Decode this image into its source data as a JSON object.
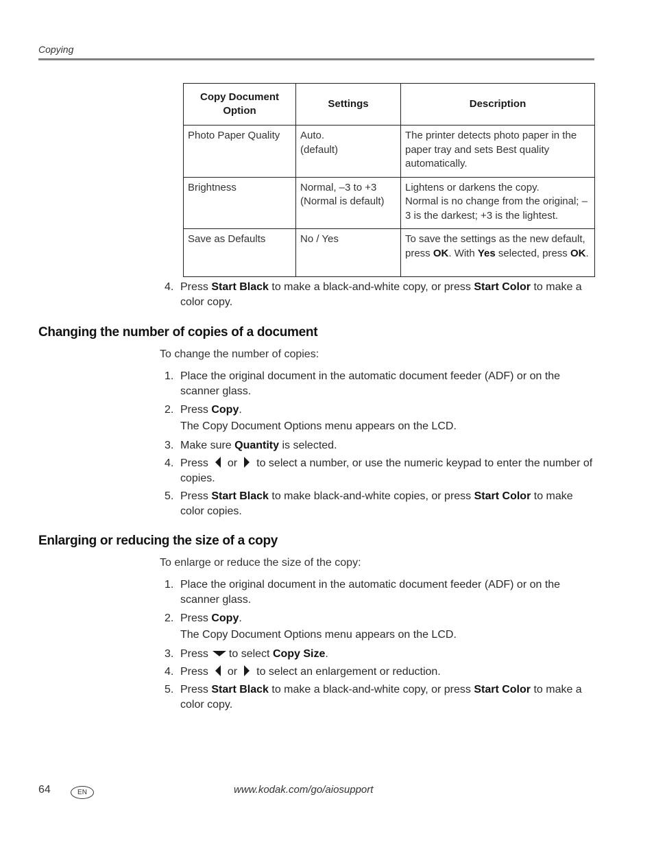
{
  "header": {
    "running_head": "Copying"
  },
  "table": {
    "headers": [
      "Copy Document Option",
      "Settings",
      "Description"
    ],
    "rows": [
      {
        "option": "Photo Paper Quality",
        "settings_line1": "Auto.",
        "settings_line2": "(default)",
        "description": "The printer detects photo paper in the paper tray and sets Best quality automatically."
      },
      {
        "option": "Brightness",
        "settings_line1": "Normal, –3 to +3",
        "settings_line2": "(Normal is default)",
        "description_line1": "Lightens or darkens the copy.",
        "description_line2": "Normal is no change from the original; –3 is the darkest; +3 is the lightest."
      },
      {
        "option": "Save as Defaults",
        "settings_line1": "No / Yes",
        "desc_part1": "To save the settings as the new default, press ",
        "desc_bold1": "OK",
        "desc_part2": ". With ",
        "desc_bold2": "Yes",
        "desc_part3": " selected, press ",
        "desc_bold3": "OK",
        "desc_part4": "."
      }
    ]
  },
  "pre_step": {
    "num": "4.",
    "t1": "Press ",
    "b1": "Start Black",
    "t2": " to make a black-and-white copy, or press ",
    "b2": "Start Color",
    "t3": " to make a color copy."
  },
  "section1": {
    "heading": "Changing the number of copies of a document",
    "intro": "To change the number of copies:",
    "steps": [
      {
        "num": "1.",
        "text": "Place the original document in the automatic document feeder (ADF) or on the scanner glass."
      },
      {
        "num": "2.",
        "t1": "Press ",
        "b1": "Copy",
        "t2": "."
      },
      {
        "num": "3.",
        "t1": "Make sure ",
        "b1": "Quantity",
        "t2": " is selected."
      },
      {
        "num": "4.",
        "t1": "Press",
        "or": "or",
        "t2": "to select a number, or use the numeric keypad to enter the number of copies.",
        "icons": [
          "left-arrow-icon",
          "right-arrow-icon"
        ]
      },
      {
        "num": "5.",
        "t1": "Press ",
        "b1": "Start Black",
        "t2": " to make black-and-white copies, or press ",
        "b2": "Start Color",
        "t3": " to make color copies."
      }
    ],
    "note": "The Copy Document Options menu appears on the LCD."
  },
  "section2": {
    "heading": "Enlarging or reducing the size of a copy",
    "intro": "To enlarge or reduce the size of the copy:",
    "steps": [
      {
        "num": "1.",
        "text": "Place the original document in the automatic document feeder (ADF) or on the scanner glass."
      },
      {
        "num": "2.",
        "t1": "Press ",
        "b1": "Copy",
        "t2": "."
      },
      {
        "num": "3.",
        "t1": "Press",
        "t2": "to select ",
        "b1": "Copy Size",
        "t3": ".",
        "icons": [
          "down-arrow-icon"
        ]
      },
      {
        "num": "4.",
        "t1": "Press",
        "or": "or",
        "t2": "to select an enlargement or reduction.",
        "icons": [
          "left-arrow-icon",
          "right-arrow-icon"
        ]
      },
      {
        "num": "5.",
        "t1": "Press ",
        "b1": "Start Black",
        "t2": " to make a black-and-white copy, or press ",
        "b2": "Start Color",
        "t3": " to make a color copy."
      }
    ],
    "note": "The Copy Document Options menu appears on the LCD."
  },
  "footer": {
    "page_number": "64",
    "language_badge": "EN",
    "url": "www.kodak.com/go/aiosupport"
  }
}
